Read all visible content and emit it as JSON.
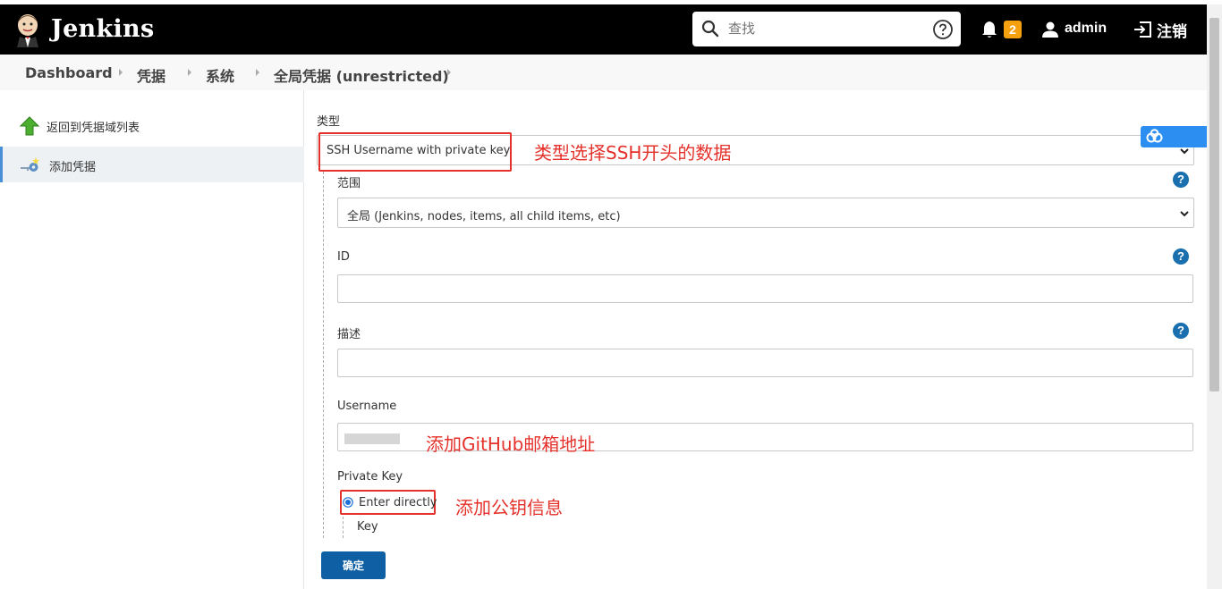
{
  "header": {
    "brand": "Jenkins",
    "search_placeholder": "查找",
    "notification_count": "2",
    "user": "admin",
    "logout": "注销"
  },
  "breadcrumb": [
    "Dashboard",
    "凭据",
    "系统",
    "全局凭据 (unrestricted)"
  ],
  "sidebar": {
    "items": [
      {
        "label": "返回到凭据域列表"
      },
      {
        "label": "添加凭据"
      }
    ]
  },
  "form": {
    "kind_label": "类型",
    "kind_value": "SSH Username with private key",
    "scope_label": "范围",
    "scope_value": "全局 (Jenkins, nodes, items, all child items, etc)",
    "id_label": "ID",
    "desc_label": "描述",
    "username_label": "Username",
    "private_key_label": "Private Key",
    "radio_enter_directly": "Enter directly",
    "key_label": "Key",
    "submit": "确定",
    "help": "?"
  },
  "annotations": {
    "kind_note": "类型选择SSH开头的数据",
    "username_note": "添加GitHub邮箱地址",
    "key_note": "添加公钥信息"
  },
  "colors": {
    "topbar": "#000000",
    "accent": "#0e5fa3",
    "annotation": "#e5312b",
    "badge": "#f5a10f"
  }
}
